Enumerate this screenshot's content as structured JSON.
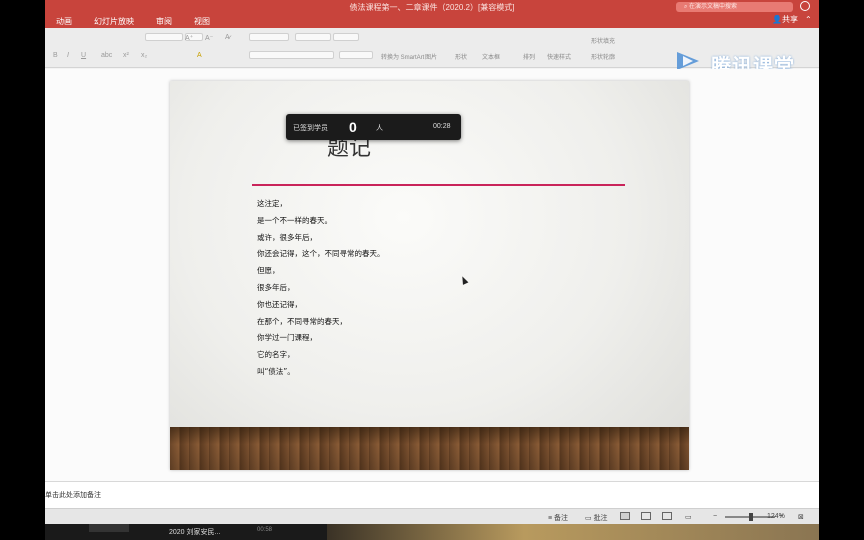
{
  "window": {
    "title": "债法课程第一、二章课件（2020.2）[兼容模式]",
    "search_placeholder": "在演示文稿中搜索",
    "share_label": "共享"
  },
  "menu": [
    "动画",
    "幻灯片放映",
    "审阅",
    "视图"
  ],
  "ribbon": {
    "convert_smartart": "转换为 SmartArt",
    "picture": "图片",
    "shape": "形状",
    "textbox": "文本框",
    "arrange": "排列",
    "quick_styles": "快速样式",
    "shape_fill": "形状填充",
    "shape_outline": "形状轮廓"
  },
  "watermark": {
    "brand": "腾讯课堂"
  },
  "slide": {
    "title": "题记",
    "lines": [
      "这注定，",
      "是一个不一样的春天。",
      "或许，很多年后，",
      "你还会记得，这个，不同寻常的春天。",
      "但愿，",
      "很多年后，",
      "你也还记得，",
      "在那个，不同寻常的春天，",
      "你学过一门课程，",
      "它的名字，",
      "叫“债法”。"
    ]
  },
  "signin_overlay": {
    "label": "已签到学员",
    "count": "0",
    "unit": "人",
    "timer": "00:28"
  },
  "notes": {
    "placeholder": "单击此处添加备注"
  },
  "statusbar": {
    "notes_label": "备注",
    "comments_label": "批注",
    "zoom": "124%"
  },
  "dock": {
    "item_label": "2020 刘家安民...",
    "item_time": "00:58"
  },
  "colors": {
    "titlebar": "#c8443c",
    "slide_rule": "#c9245a"
  }
}
